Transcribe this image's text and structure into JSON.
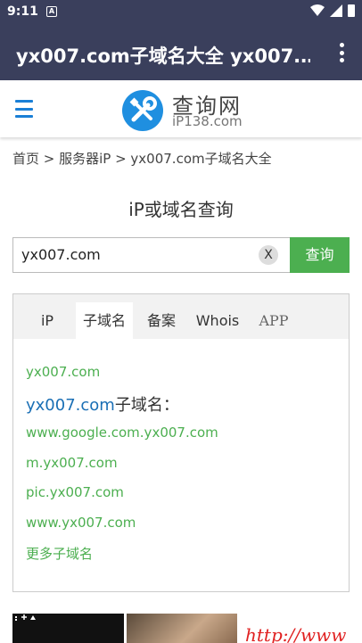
{
  "status_bar": {
    "time": "9:11",
    "notification_glyph": "A"
  },
  "app_bar": {
    "title": "yx007.com子域名大全 yx007.…"
  },
  "site": {
    "brand": "查询网",
    "domain": "iP138.com"
  },
  "breadcrumb": "首页 > 服务器iP > yx007.com子域名大全",
  "search": {
    "heading": "iP或域名查询",
    "value": "yx007.com",
    "clear_label": "X",
    "submit_label": "查询"
  },
  "tabs": [
    {
      "label": "iP",
      "active": false
    },
    {
      "label": "子域名",
      "active": true
    },
    {
      "label": "备案",
      "active": false
    },
    {
      "label": "Whois",
      "active": false
    },
    {
      "label": "APP",
      "active": false
    }
  ],
  "results": {
    "domain_link": "yx007.com",
    "subdomain_heading_domain": "yx007.com",
    "subdomain_heading_suffix": "子域名：",
    "subdomains": [
      "www.google.com.yx007.com",
      "m.yx007.com",
      "pic.yx007.com",
      "www.yx007.com"
    ],
    "more_link": "更多子域名"
  },
  "ads": {
    "ad3_text": "http://www"
  },
  "colors": {
    "app_bar": "#3a3f5c",
    "accent_green": "#4caf50",
    "link_blue": "#1a6fb5"
  }
}
